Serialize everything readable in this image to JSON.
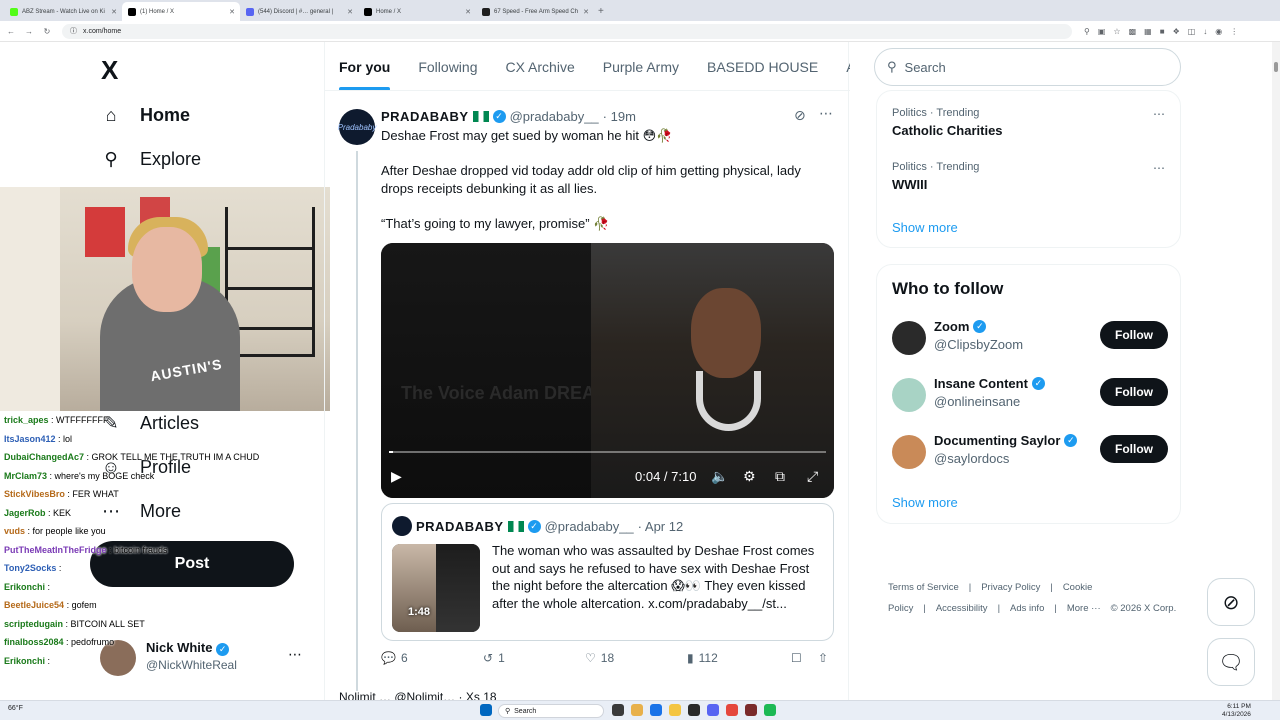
{
  "browser": {
    "tabs": [
      {
        "title": "ABZ Stream - Watch Live on Ki",
        "color": "#53fc18",
        "active": false
      },
      {
        "title": "(1) Home / X",
        "color": "#000000",
        "active": true
      },
      {
        "title": "(544) Discord | #… general |",
        "color": "#5865f2",
        "active": false
      },
      {
        "title": "Home / X",
        "color": "#000000",
        "active": false
      },
      {
        "title": "67 Speed - Free Arm Speed Ch",
        "color": "#1f1f1f",
        "active": false
      }
    ],
    "url": "x.com/home"
  },
  "sidebar": {
    "logo": "X",
    "items": [
      {
        "label": "Home",
        "icon": "home-icon"
      },
      {
        "label": "Explore",
        "icon": "search-icon"
      },
      {
        "label": "Articles",
        "icon": "article-icon"
      },
      {
        "label": "Profile",
        "icon": "profile-icon"
      },
      {
        "label": "More",
        "icon": "more-icon"
      }
    ],
    "post_label": "Post",
    "account": {
      "name": "Nick White",
      "handle": "@NickWhiteReal"
    }
  },
  "webcam": {
    "shirt_text": "AUSTIN'S"
  },
  "chat": [
    {
      "user": "trick_apes",
      "msg": ": WTFFFFFFF",
      "c": ""
    },
    {
      "user": "ItsJason412",
      "msg": ": lol",
      "c": "b"
    },
    {
      "user": "DubaiChangedAc7",
      "msg": ": GROK TELL ME THE TRUTH IM A CHUD",
      "c": ""
    },
    {
      "user": "MrClam73",
      "msg": ": where's my BOGE check",
      "c": ""
    },
    {
      "user": "StickVibesBro",
      "msg": ": FER WHAT",
      "c": "o"
    },
    {
      "user": "JagerRob",
      "msg": ": KEK",
      "c": ""
    },
    {
      "user": "vuds",
      "msg": ": for people like you",
      "c": "o"
    },
    {
      "user": "PutTheMeatInTheFridge",
      "msg": ": bitcoin frauds",
      "c": "p"
    },
    {
      "user": "Tony2Socks",
      "msg": ":",
      "c": "b"
    },
    {
      "user": "Erikonchi",
      "msg": ":",
      "c": ""
    },
    {
      "user": "BeetleJuice54",
      "msg": ": gofem",
      "c": "o"
    },
    {
      "user": "scriptedugain",
      "msg": ": BITCOIN ALL SET",
      "c": ""
    },
    {
      "user": "finalboss2084",
      "msg": ": pedofrumo",
      "c": ""
    },
    {
      "user": "Erikonchi",
      "msg": ":",
      "c": ""
    }
  ],
  "feed": {
    "tabs": [
      "For you",
      "Following",
      "CX Archive",
      "Purple Army",
      "BASEDD HOUSE",
      "Ape"
    ],
    "tweet": {
      "avatar_text": "Pradababy",
      "name": "PRADABABY",
      "handle": "@pradababy__",
      "time": "· 19m",
      "lines": [
        "Deshae Frost may get sued by woman he hit 😳🥀",
        "After Deshae dropped vid today addr old clip of him getting physical, lady drops receipts debunking it as all lies.",
        "“That’s going to my lawyer, promise” 🥀"
      ],
      "video": {
        "watermark": "The Voice Adam DREACTS",
        "time": "0:04 / 7:10",
        "progress": 0.01
      },
      "quote": {
        "name": "PRADABABY",
        "handle": "@pradababy__",
        "date": "· Apr 12",
        "duration": "1:48",
        "text": "The woman who was assaulted by Deshae Frost comes out and says he refused to have sex with Deshae Frost the night before the altercation 😱👀 They even kissed after the whole altercation. x.com/pradababy__/st..."
      },
      "stats": {
        "replies": "6",
        "reposts": "1",
        "likes": "18",
        "views": "112"
      }
    },
    "next_tweet": "Nolimit … @Nolimit… · Xs 18"
  },
  "right": {
    "search_placeholder": "Search",
    "trends": [
      {
        "context": "Politics · Trending",
        "name": "Catholic Charities"
      },
      {
        "context": "Politics · Trending",
        "name": "WWIII"
      }
    ],
    "show_more": "Show more",
    "who_to_follow": "Who to follow",
    "follow": [
      {
        "name": "Zoom",
        "handle": "@ClipsbyZoom",
        "color": "#2a2a2a"
      },
      {
        "name": "Insane Content",
        "handle": "@onlineinsane",
        "color": "#a8d3c5"
      },
      {
        "name": "Documenting Saylor",
        "handle": "@saylordocs",
        "color": "#c98a58"
      }
    ],
    "follow_label": "Follow",
    "footer": [
      "Terms of Service",
      "|",
      "Privacy Policy",
      "|",
      "Cookie Policy",
      "|",
      "Accessibility",
      "|",
      "Ads info",
      "|",
      "More ···",
      "© 2026 X Corp."
    ]
  },
  "taskbar": {
    "weather": "66°F",
    "search": "Search",
    "time": "6:11 PM",
    "date": "4/13/2026"
  }
}
